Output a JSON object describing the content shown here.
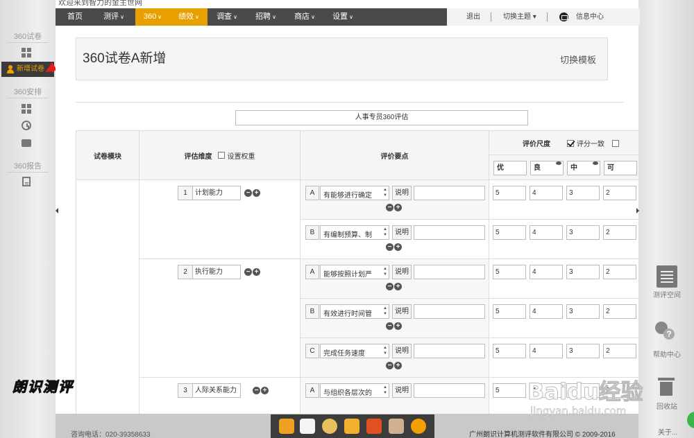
{
  "top": {
    "welcome_text": "欢迎来到智力的金主世网"
  },
  "nav": {
    "items": [
      {
        "label": "首页",
        "caret": ""
      },
      {
        "label": "测评",
        "caret": "∨"
      },
      {
        "label": "360",
        "caret": "∨"
      },
      {
        "label": "绩效",
        "caret": "∨"
      },
      {
        "label": "调查",
        "caret": "∨"
      },
      {
        "label": "招聘",
        "caret": "∨"
      },
      {
        "label": "商店",
        "caret": "∨"
      },
      {
        "label": "设置",
        "caret": "∨"
      }
    ],
    "logout": "退出",
    "switch_theme": "切换主题",
    "switch_caret": "▾",
    "message_center": "信息中心",
    "accent": "#e8a000"
  },
  "sidebar": {
    "section_quiz": "360试卷",
    "new_quiz": "新增试卷",
    "section_schedule": "360安排",
    "section_report": "360报告",
    "active_color": "#f0a000"
  },
  "page": {
    "title": "360试卷A新增",
    "switch_template": "切换模板",
    "survey_name": "人事专员360评估"
  },
  "table": {
    "col_module": "试卷模块",
    "col_dimension": "评估维度",
    "set_weight": "设置权重",
    "col_points": "评价要点",
    "col_scale": "评价尺度",
    "score_consistent": "评分一致",
    "grades": [
      "优",
      "良",
      "中",
      "可"
    ],
    "dimensions": [
      {
        "no": "1",
        "name": "计划能力",
        "points": [
          {
            "letter": "A",
            "text": "有能够进行确定",
            "explain": "说明",
            "scores": [
              "5",
              "4",
              "3",
              "2"
            ]
          },
          {
            "letter": "B",
            "text": "有编制预算、制",
            "explain": "说明",
            "scores": [
              "5",
              "4",
              "3",
              "2"
            ]
          }
        ]
      },
      {
        "no": "2",
        "name": "执行能力",
        "points": [
          {
            "letter": "A",
            "text": "能够按照计划严",
            "explain": "说明",
            "scores": [
              "5",
              "4",
              "3",
              "2"
            ]
          },
          {
            "letter": "B",
            "text": "有效进行时间管",
            "explain": "说明",
            "scores": [
              "5",
              "4",
              "3",
              "2"
            ]
          },
          {
            "letter": "C",
            "text": "完成任务速度",
            "explain": "说明",
            "scores": [
              "5",
              "4",
              "3",
              "2"
            ]
          }
        ]
      },
      {
        "no": "3",
        "name": "人际关系能力",
        "points": [
          {
            "letter": "A",
            "text": "与组织各层次的",
            "explain": "说明",
            "scores": [
              "5",
              "4",
              "3",
              "2"
            ]
          }
        ]
      }
    ]
  },
  "right_side": {
    "test_space": "测评空间",
    "help_center": "帮助中心",
    "recycle_bin": "回收站",
    "about": "关于..."
  },
  "footer": {
    "phone": "咨询电话：020-39358633",
    "copyright": "广州朗识计算机测评软件有限公司 © 2009-2016"
  },
  "watermarks": {
    "brand": "朗识测评",
    "baidu": "Baidu经验",
    "baidu_url": "jingyan.baidu.com"
  }
}
